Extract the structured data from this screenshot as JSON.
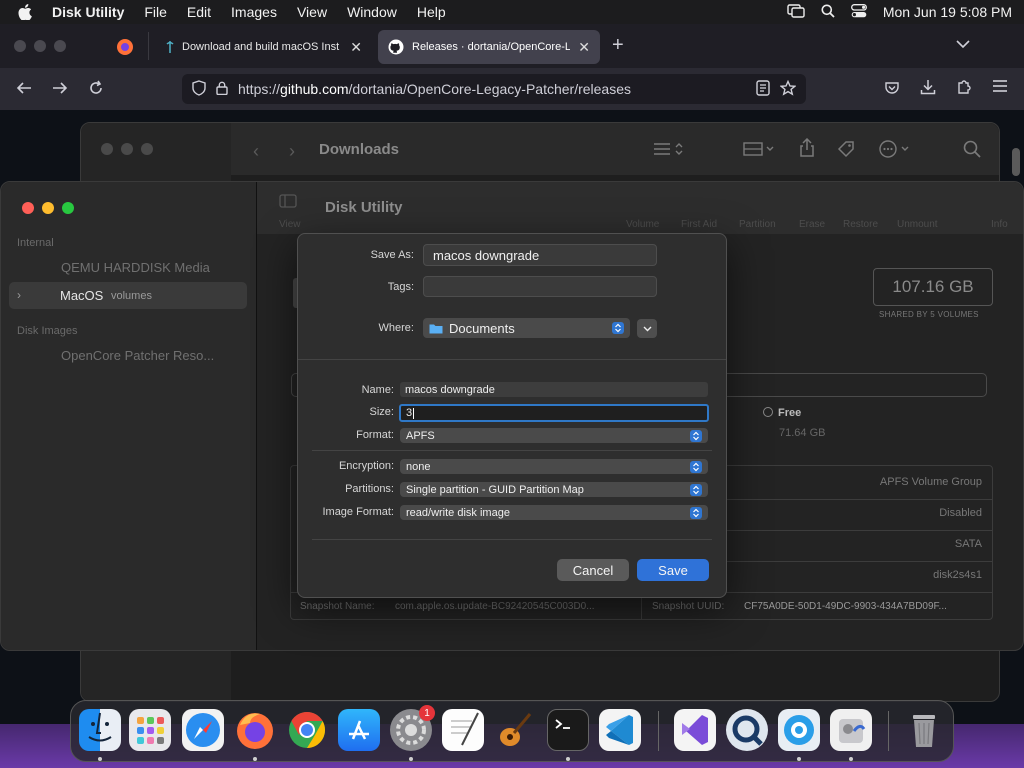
{
  "menubar": {
    "app_name": "Disk Utility",
    "items": [
      "File",
      "Edit",
      "Images",
      "View",
      "Window",
      "Help"
    ],
    "clock": "Mon Jun 19  5:08 PM"
  },
  "browser": {
    "tabs": [
      {
        "title": "Download and build macOS Inst"
      },
      {
        "title": "Releases · dortania/OpenCore-L"
      }
    ],
    "url_prefix": "https://",
    "url_host": "github.com",
    "url_path": "/dortania/OpenCore-Legacy-Patcher/releases"
  },
  "finder": {
    "title": "Downloads"
  },
  "disk_utility": {
    "title": "Disk Utility",
    "sidebar": {
      "internal_header": "Internal",
      "internal_items": [
        {
          "label": "QEMU HARDDISK Media"
        },
        {
          "label": "MacOS",
          "sub": "volumes"
        }
      ],
      "images_header": "Disk Images",
      "image_items": [
        {
          "label": "OpenCore Patcher Reso..."
        }
      ]
    },
    "toolbar_labels": [
      "View",
      "Volume",
      "First Aid",
      "Partition",
      "Erase",
      "Restore",
      "Unmount",
      "Info"
    ],
    "capacity": "107.16 GB",
    "capacity_caption": "SHARED BY 5 VOLUMES",
    "free_label": "Free",
    "free_value": "71.64 GB",
    "info_rows": [
      "APFS Volume Group",
      "Disabled",
      "SATA",
      "disk2s4s1"
    ],
    "snapshot_name_label": "Snapshot Name:",
    "snapshot_name_value": "com.apple.os.update-BC92420545C003D0...",
    "snapshot_uuid_label": "Snapshot UUID:",
    "snapshot_uuid_value": "CF75A0DE-50D1-49DC-9903-434A7BD09F..."
  },
  "dialog": {
    "save_as_label": "Save As:",
    "save_as_value": "macos downgrade",
    "tags_label": "Tags:",
    "where_label": "Where:",
    "where_value": "Documents",
    "name_label": "Name:",
    "name_value": "macos downgrade",
    "size_label": "Size:",
    "size_value": "3",
    "format_label": "Format:",
    "format_value": "APFS",
    "encryption_label": "Encryption:",
    "encryption_value": "none",
    "partitions_label": "Partitions:",
    "partitions_value": "Single partition - GUID Partition Map",
    "image_format_label": "Image Format:",
    "image_format_value": "read/write disk image",
    "cancel_label": "Cancel",
    "save_label": "Save"
  },
  "dock": {
    "apps": [
      "Finder",
      "Launchpad",
      "Safari",
      "Firefox",
      "Chrome",
      "App Store",
      "System Settings",
      "TextEdit",
      "GarageBand",
      "Terminal",
      "VS Code",
      "Visual Studio",
      "QuickTime",
      "OpenCore",
      "Disk Utility",
      "Trash"
    ],
    "settings_badge": "1"
  },
  "colors": {
    "accent": "#2f72d8",
    "close": "#ff5f57",
    "minimize": "#febc2e",
    "zoom": "#28c840"
  }
}
